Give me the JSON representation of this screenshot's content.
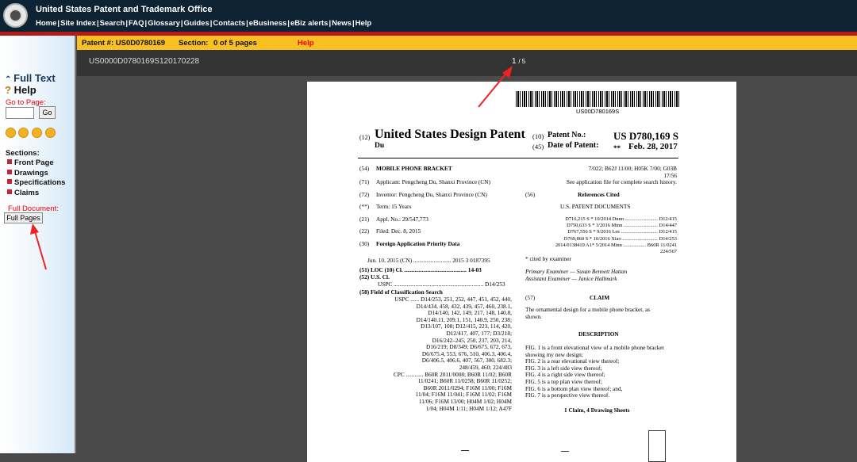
{
  "header": {
    "title": "United States Patent and Trademark Office",
    "nav": [
      "Home",
      "Site Index",
      "Search",
      "FAQ",
      "Glossary",
      "Guides",
      "Contacts",
      "eBusiness",
      "eBiz alerts",
      "News",
      "Help"
    ]
  },
  "sidebar": {
    "full_text": "Full Text",
    "help": "Help",
    "goto_label": "Go to Page:",
    "go_button": "Go",
    "sections_label": "Sections:",
    "sections": [
      "Front Page",
      "Drawings",
      "Specifications",
      "Claims"
    ],
    "full_document_label": "Full Document:",
    "full_pages_button": "Full Pages"
  },
  "toolbar": {
    "patent": "Patent #: US0D0780169",
    "section": "Section:",
    "section_value": "0 of 5 pages",
    "help": "Help"
  },
  "viewer": {
    "doc_id": "US0000D0780169S120170228",
    "page": "1",
    "page_total": "/ 5"
  },
  "doc": {
    "barcode_number": "US00D780169S",
    "code12": "(12)",
    "title": "United States Design Patent",
    "inventor_short": "Du",
    "code10": "(10)",
    "patent_no_label": "Patent No.:",
    "patent_no": "US D780,169 S",
    "code45": "(45)",
    "date_label": "Date of Patent:",
    "date_stars": "**",
    "date": "Feb. 28, 2017",
    "left_lines": [
      {
        "code": "(54)",
        "text": "MOBILE PHONE BRACKET",
        "bold": true
      },
      {
        "code": "(71)",
        "text": "Applicant: Pengcheng Du, Shanxi Province (CN)"
      },
      {
        "code": "(72)",
        "text": "Inventor: Pengcheng Du, Shanxi Province (CN)"
      },
      {
        "code": "(**)",
        "text": "Term:     15 Years"
      },
      {
        "code": "(21)",
        "text": "Appl. No.: 29/547,773"
      },
      {
        "code": "(22)",
        "text": "Filed:     Dec. 8, 2015"
      },
      {
        "code": "(30)",
        "text": "Foreign Application Priority Data",
        "bold": true
      }
    ],
    "priority": "Jun. 10, 2015   (CN) .......................... 2015 3 0187395",
    "loc": "(51)  LOC (10) Cl.  ...........................................  14-03",
    "uscl": "(52)  U.S. Cl.",
    "uspc": "USPC  ..............................................................  D14/253",
    "field": "(58)  Field of Classification Search",
    "uspc_search": [
      "USPC ...... D14/253, 251, 252, 447, 451, 452, 440,",
      "D14/434, 458, 432, 439, 457, 460, 238.1,",
      "D14/140, 142, 149, 217, 148, 140.8,",
      "D14/140.11, 209.1, 151, 140.9, 250, 238;",
      "D13/107, 108; D12/415, 223, 114, 420,",
      "D12/417, 407, 177; D3/218;",
      "D16/242–245, 250, 237, 203, 214,",
      "D16/219; D8/349; D6/675, 672, 673,",
      "D6/675.4, 553, 676, 510, 406.3, 406.4,",
      "D6/406.5, 406.6, 407, 567, 300, 682.3;",
      "248/459, 460; 224/483",
      "CPC ............ B60R 2011/0008; B60R 11/02; B60R",
      "11/0241; B60R 11/0258; B60R 11/0252;",
      "B60R 2011/0294; F16M 11/00; F16M",
      "11/04;  F16M 11/041; F16M 11/02; F16M",
      "11/06;  F16M 13/00; H04M 1/02; H04M",
      "1/04;  H04M 1/11; H04M 1/12; A47F"
    ],
    "right_top": [
      "7/022; B62J 11/00; H05K 7/00; G03B",
      "17/56",
      "See application file for complete search history."
    ],
    "refs_code": "(56)",
    "refs_title": "References Cited",
    "refs_sub": "U.S. PATENT DOCUMENTS",
    "refs": [
      "D716,215 S  *  10/2014  Dunn  .......................... D12/415",
      "D750,633 S  *   3/2016  Minn  ........................... D14/447",
      "D767,556 S  *   9/2016  Lee  ............................. D12/415",
      "D769,860 S  *  10/2016  Xiao  ............................ D14/253",
      "2014/0138419 A1*   5/2014  Minn  .................. B60R 11/0241",
      "224/567"
    ],
    "cited": "* cited by examiner",
    "primary": "Primary Examiner — Susan Bennett Hattan",
    "assistant": "Assistant Examiner — Janice Hallmark",
    "claim_code": "(57)",
    "claim_title": "CLAIM",
    "claim_text": [
      "The ornamental design for a mobile phone bracket, as",
      "shown."
    ],
    "desc_title": "DESCRIPTION",
    "desc": [
      "FIG. 1 is a front elevational view of a mobile phone bracket",
      "showing my new design;",
      "FIG. 2 is a rear elevational view thereof;",
      "FIG. 3 is a left side view thereof;",
      "FIG. 4 is a right side view thereof;",
      "FIG. 5 is a top plan view thereof;",
      "FIG. 6 is a bottom plan view thereof; and,",
      "FIG. 7 is a perspective view thereof."
    ],
    "sheets": "1 Claim, 4 Drawing Sheets"
  }
}
